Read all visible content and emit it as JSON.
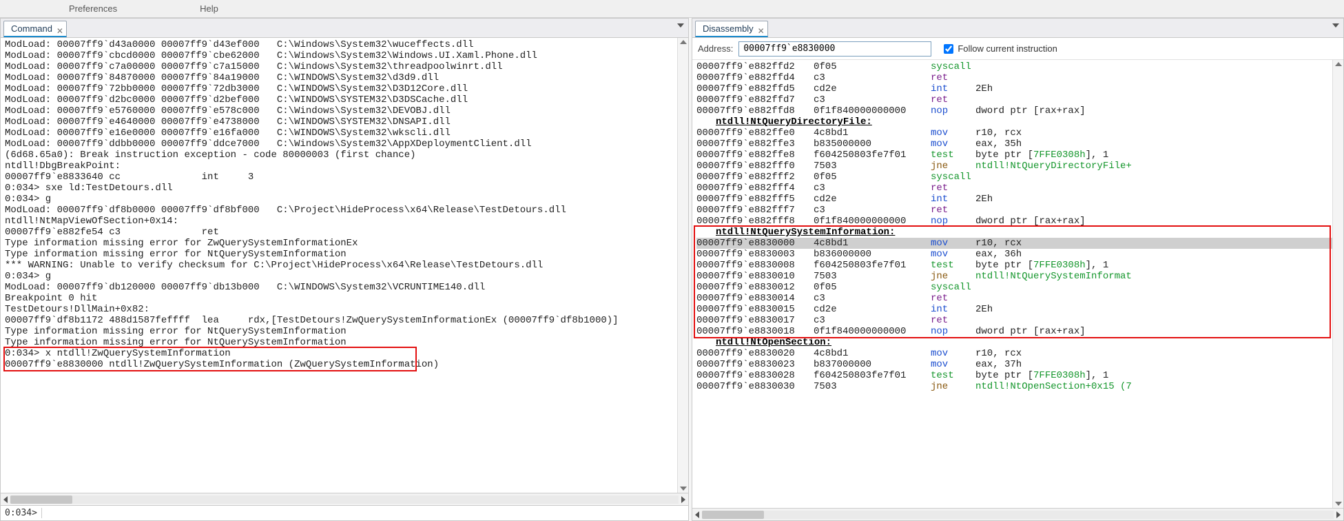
{
  "menubar": {
    "preferences": "Preferences",
    "help": "Help"
  },
  "left_panel": {
    "title": "Command",
    "prompt": "0:034>"
  },
  "right_panel": {
    "title": "Disassembly",
    "addr_label": "Address:",
    "addr_value": "00007ff9`e8830000",
    "follow_label": "Follow current instruction",
    "follow_checked": true
  },
  "command_lines": [
    "ModLoad: 00007ff9`d43a0000 00007ff9`d43ef000   C:\\Windows\\System32\\wuceffects.dll",
    "ModLoad: 00007ff9`cbcd0000 00007ff9`cbe62000   C:\\Windows\\System32\\Windows.UI.Xaml.Phone.dll",
    "ModLoad: 00007ff9`c7a00000 00007ff9`c7a15000   C:\\Windows\\System32\\threadpoolwinrt.dll",
    "ModLoad: 00007ff9`84870000 00007ff9`84a19000   C:\\WINDOWS\\System32\\d3d9.dll",
    "ModLoad: 00007ff9`72bb0000 00007ff9`72db3000   C:\\WINDOWS\\System32\\D3D12Core.dll",
    "ModLoad: 00007ff9`d2bc0000 00007ff9`d2bef000   C:\\WINDOWS\\SYSTEM32\\D3DSCache.dll",
    "ModLoad: 00007ff9`e5760000 00007ff9`e578c000   C:\\Windows\\System32\\DEVOBJ.dll",
    "ModLoad: 00007ff9`e4640000 00007ff9`e4738000   C:\\WINDOWS\\SYSTEM32\\DNSAPI.dll",
    "ModLoad: 00007ff9`e16e0000 00007ff9`e16fa000   C:\\WINDOWS\\System32\\wkscli.dll",
    "ModLoad: 00007ff9`ddbb0000 00007ff9`ddce7000   C:\\Windows\\System32\\AppXDeploymentClient.dll",
    "(6d68.65a0): Break instruction exception - code 80000003 (first chance)",
    "ntdll!DbgBreakPoint:",
    "00007ff9`e8833640 cc              int     3",
    "0:034> sxe ld:TestDetours.dll",
    "0:034> g",
    "ModLoad: 00007ff9`df8b0000 00007ff9`df8bf000   C:\\Project\\HideProcess\\x64\\Release\\TestDetours.dll",
    "ntdll!NtMapViewOfSection+0x14:",
    "00007ff9`e882fe54 c3              ret",
    "Type information missing error for ZwQuerySystemInformationEx",
    "Type information missing error for NtQuerySystemInformation",
    "*** WARNING: Unable to verify checksum for C:\\Project\\HideProcess\\x64\\Release\\TestDetours.dll",
    "0:034> g",
    "ModLoad: 00007ff9`db120000 00007ff9`db13b000   C:\\WINDOWS\\System32\\VCRUNTIME140.dll",
    "Breakpoint 0 hit",
    "TestDetours!DllMain+0x82:",
    "00007ff9`df8b1172 488d1587feffff  lea     rdx,[TestDetours!ZwQuerySystemInformationEx (00007ff9`df8b1000)]",
    "Type information missing error for NtQuerySystemInformation",
    "Type information missing error for NtQuerySystemInformation",
    "0:034> x ntdll!ZwQuerySystemInformation",
    "00007ff9`e8830000 ntdll!ZwQuerySystemInformation (ZwQuerySystemInformation)"
  ],
  "disassembly": [
    {
      "t": "row",
      "addr": "00007ff9`e882ffd2",
      "bytes": "0f05",
      "mnem": "syscall",
      "mclr": "green",
      "op": ""
    },
    {
      "t": "row",
      "addr": "00007ff9`e882ffd4",
      "bytes": "c3",
      "mnem": "ret",
      "mclr": "purple",
      "op": ""
    },
    {
      "t": "row",
      "addr": "00007ff9`e882ffd5",
      "bytes": "cd2e",
      "mnem": "int",
      "mclr": "blue",
      "op": "2Eh"
    },
    {
      "t": "row",
      "addr": "00007ff9`e882ffd7",
      "bytes": "c3",
      "mnem": "ret",
      "mclr": "purple",
      "op": ""
    },
    {
      "t": "row",
      "addr": "00007ff9`e882ffd8",
      "bytes": "0f1f840000000000",
      "mnem": "nop",
      "mclr": "blue",
      "op": "dword ptr [rax+rax]"
    },
    {
      "t": "sym",
      "label": "ntdll!NtQueryDirectoryFile:"
    },
    {
      "t": "row",
      "addr": "00007ff9`e882ffe0",
      "bytes": "4c8bd1",
      "mnem": "mov",
      "mclr": "blue",
      "op": "r10, rcx"
    },
    {
      "t": "row",
      "addr": "00007ff9`e882ffe3",
      "bytes": "b835000000",
      "mnem": "mov",
      "mclr": "blue",
      "op": "eax, 35h"
    },
    {
      "t": "row",
      "addr": "00007ff9`e882ffe8",
      "bytes": "f604250803fe7f01",
      "mnem": "test",
      "mclr": "green",
      "op_parts": [
        "byte ptr [",
        {
          "c": "green",
          "v": "7FFE0308h"
        },
        {
          "c": "",
          "v": "], 1"
        }
      ]
    },
    {
      "t": "row",
      "addr": "00007ff9`e882fff0",
      "bytes": "7503",
      "mnem": "jne",
      "mclr": "brown",
      "op_parts": [
        {
          "c": "green",
          "v": "ntdll!NtQueryDirectoryFile+"
        }
      ]
    },
    {
      "t": "row",
      "addr": "00007ff9`e882fff2",
      "bytes": "0f05",
      "mnem": "syscall",
      "mclr": "green",
      "op": ""
    },
    {
      "t": "row",
      "addr": "00007ff9`e882fff4",
      "bytes": "c3",
      "mnem": "ret",
      "mclr": "purple",
      "op": ""
    },
    {
      "t": "row",
      "addr": "00007ff9`e882fff5",
      "bytes": "cd2e",
      "mnem": "int",
      "mclr": "blue",
      "op": "2Eh"
    },
    {
      "t": "row",
      "addr": "00007ff9`e882fff7",
      "bytes": "c3",
      "mnem": "ret",
      "mclr": "purple",
      "op": ""
    },
    {
      "t": "row",
      "addr": "00007ff9`e882fff8",
      "bytes": "0f1f840000000000",
      "mnem": "nop",
      "mclr": "blue",
      "op": "dword ptr [rax+rax]"
    },
    {
      "t": "sym",
      "label": "ntdll!NtQuerySystemInformation:"
    },
    {
      "t": "row",
      "hl": true,
      "addr": "00007ff9`e8830000",
      "bytes": "4c8bd1",
      "mnem": "mov",
      "mclr": "blue",
      "op": "r10, rcx"
    },
    {
      "t": "row",
      "addr": "00007ff9`e8830003",
      "bytes": "b836000000",
      "mnem": "mov",
      "mclr": "blue",
      "op": "eax, 36h"
    },
    {
      "t": "row",
      "addr": "00007ff9`e8830008",
      "bytes": "f604250803fe7f01",
      "mnem": "test",
      "mclr": "green",
      "op_parts": [
        "byte ptr [",
        {
          "c": "green",
          "v": "7FFE0308h"
        },
        {
          "c": "",
          "v": "], 1"
        }
      ]
    },
    {
      "t": "row",
      "addr": "00007ff9`e8830010",
      "bytes": "7503",
      "mnem": "jne",
      "mclr": "brown",
      "op_parts": [
        {
          "c": "green",
          "v": "ntdll!NtQuerySystemInformat"
        }
      ]
    },
    {
      "t": "row",
      "addr": "00007ff9`e8830012",
      "bytes": "0f05",
      "mnem": "syscall",
      "mclr": "green",
      "op": ""
    },
    {
      "t": "row",
      "addr": "00007ff9`e8830014",
      "bytes": "c3",
      "mnem": "ret",
      "mclr": "purple",
      "op": ""
    },
    {
      "t": "row",
      "addr": "00007ff9`e8830015",
      "bytes": "cd2e",
      "mnem": "int",
      "mclr": "blue",
      "op": "2Eh"
    },
    {
      "t": "row",
      "addr": "00007ff9`e8830017",
      "bytes": "c3",
      "mnem": "ret",
      "mclr": "purple",
      "op": ""
    },
    {
      "t": "row",
      "addr": "00007ff9`e8830018",
      "bytes": "0f1f840000000000",
      "mnem": "nop",
      "mclr": "blue",
      "op": "dword ptr [rax+rax]"
    },
    {
      "t": "sym",
      "label": "ntdll!NtOpenSection:"
    },
    {
      "t": "row",
      "addr": "00007ff9`e8830020",
      "bytes": "4c8bd1",
      "mnem": "mov",
      "mclr": "blue",
      "op": "r10, rcx"
    },
    {
      "t": "row",
      "addr": "00007ff9`e8830023",
      "bytes": "b837000000",
      "mnem": "mov",
      "mclr": "blue",
      "op": "eax, 37h"
    },
    {
      "t": "row",
      "addr": "00007ff9`e8830028",
      "bytes": "f604250803fe7f01",
      "mnem": "test",
      "mclr": "green",
      "op_parts": [
        "byte ptr [",
        {
          "c": "green",
          "v": "7FFE0308h"
        },
        {
          "c": "",
          "v": "], 1"
        }
      ]
    },
    {
      "t": "row",
      "addr": "00007ff9`e8830030",
      "bytes": "7503",
      "mnem": "jne",
      "mclr": "brown",
      "op_parts": [
        {
          "c": "green",
          "v": "ntdll!NtOpenSection+0x15 (7"
        }
      ]
    }
  ]
}
